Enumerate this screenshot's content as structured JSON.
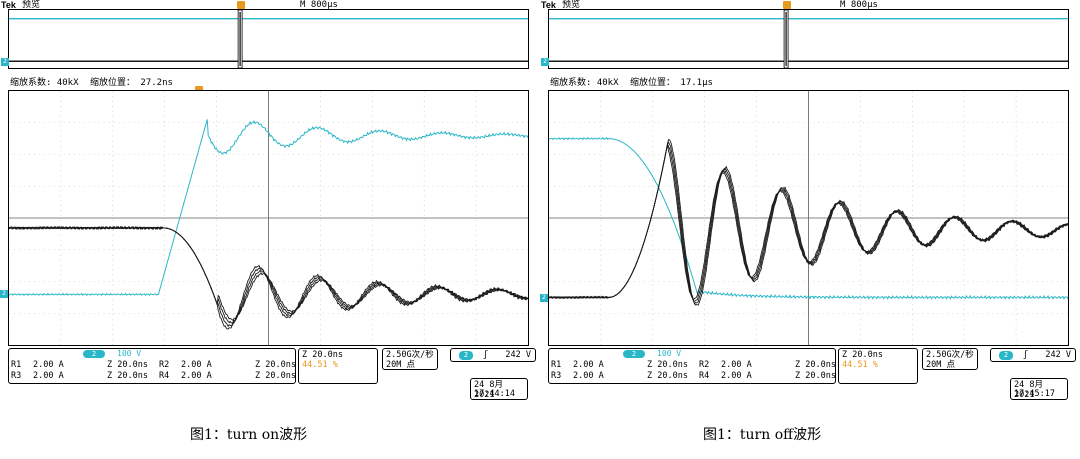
{
  "scopes": [
    {
      "brand": "Tek",
      "mode": "预览",
      "timebase": "M 800µs",
      "zoom_factor": "缩放系数: 40kX",
      "zoom_position": "缩放位置： 27.2ns",
      "ch2_scale": "100 V",
      "ch2_badge": "2",
      "refs": [
        {
          "label": "R1",
          "scale": "2.00 A",
          "time": "Z 20.0ns"
        },
        {
          "label": "R2",
          "scale": "2.00 A",
          "time": "Z 20.0ns"
        },
        {
          "label": "R3",
          "scale": "2.00 A",
          "time": "Z 20.0ns"
        },
        {
          "label": "R4",
          "scale": "2.00 A",
          "time": "Z 20.0ns"
        }
      ],
      "zoom_time": "Z 20.0ns",
      "trigger_pos": "44.51 %",
      "sample_rate": "2.50G次/秒",
      "record_len": "20M 点",
      "trig_channel": "2",
      "trig_slope": "ʃ",
      "trig_level": "242 V",
      "date": "24 8月  2021",
      "time": "17:44:14",
      "caption": "图1：turn on波形",
      "waveform": "turn-on",
      "colors": {
        "ch2": "#29b6c9",
        "current": "#1a1a1a",
        "trigger": "#e89a1c"
      }
    },
    {
      "brand": "Tek",
      "mode": "预览",
      "timebase": "M 800µs",
      "zoom_factor": "缩放系数: 40kX",
      "zoom_position": "缩放位置： 17.1µs",
      "ch2_scale": "100 V",
      "ch2_badge": "2",
      "refs": [
        {
          "label": "R1",
          "scale": "2.00 A",
          "time": "Z 20.0ns"
        },
        {
          "label": "R2",
          "scale": "2.00 A",
          "time": "Z 20.0ns"
        },
        {
          "label": "R3",
          "scale": "2.00 A",
          "time": "Z 20.0ns"
        },
        {
          "label": "R4",
          "scale": "2.00 A",
          "time": "Z 20.0ns"
        }
      ],
      "zoom_time": "Z 20.0ns",
      "trigger_pos": "44.51 %",
      "sample_rate": "2.50G次/秒",
      "record_len": "20M 点",
      "trig_channel": "2",
      "trig_slope": "ʃ",
      "trig_level": "242 V",
      "date": "24 8月  2021",
      "time": "17:45:17",
      "caption": "图1：turn off波形",
      "waveform": "turn-off",
      "colors": {
        "ch2": "#29b6c9",
        "current": "#1a1a1a",
        "trigger": "#e89a1c"
      }
    }
  ]
}
